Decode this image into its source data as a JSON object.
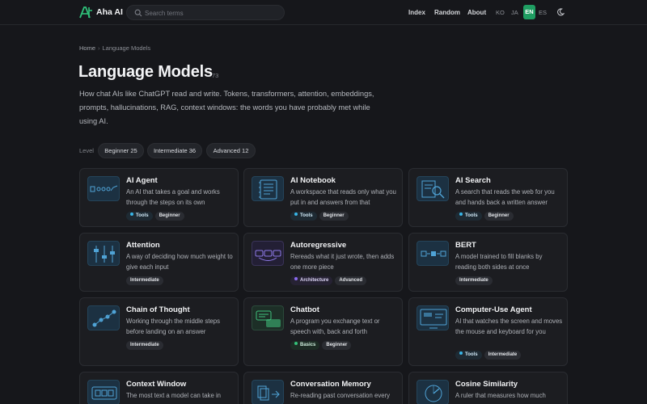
{
  "header": {
    "brand": "Aha AI",
    "search_placeholder": "Search terms",
    "nav": [
      "Index",
      "Random",
      "About"
    ],
    "languages": [
      "KO",
      "JA",
      "EN",
      "ES"
    ],
    "active_language": "EN"
  },
  "breadcrumb": {
    "home": "Home",
    "separator": "›",
    "current": "Language Models"
  },
  "page": {
    "title": "Language Models",
    "count": "73",
    "intro": "How chat AIs like ChatGPT read and write. Tokens, transformers, attention, embeddings, prompts, hallucinations, RAG, context windows: the words you have probably met while using AI."
  },
  "levels": {
    "label": "Level",
    "chips": [
      "Beginner 25",
      "Intermediate 36",
      "Advanced 12"
    ]
  },
  "cards": [
    {
      "title": "AI Agent",
      "desc": "An AI that takes a goal and works through the steps on its own",
      "category": "Tools",
      "level": "Beginner",
      "icon": "agent-icon"
    },
    {
      "title": "AI Notebook",
      "desc": "A workspace that reads only what you put in and answers from that",
      "category": "Tools",
      "level": "Beginner",
      "icon": "notebook-icon"
    },
    {
      "title": "AI Search",
      "desc": "A search that reads the web for you and hands back a written answer",
      "category": "Tools",
      "level": "Beginner",
      "icon": "search-doc-icon"
    },
    {
      "title": "Attention",
      "desc": "A way of deciding how much weight to give each input",
      "category": "",
      "level": "Intermediate",
      "icon": "sliders-icon"
    },
    {
      "title": "Autoregressive",
      "desc": "Rereads what it just wrote, then adds one more piece",
      "category": "Architecture",
      "level": "Advanced",
      "icon": "sequence-icon"
    },
    {
      "title": "BERT",
      "desc": "A model trained to fill blanks by reading both sides at once",
      "category": "",
      "level": "Intermediate",
      "icon": "bidirectional-icon"
    },
    {
      "title": "Chain of Thought",
      "desc": "Working through the middle steps before landing on an answer",
      "category": "",
      "level": "Intermediate",
      "icon": "chain-icon"
    },
    {
      "title": "Chatbot",
      "desc": "A program you exchange text or speech with, back and forth",
      "category": "Basics",
      "level": "Beginner",
      "icon": "chat-icon"
    },
    {
      "title": "Computer-Use Agent",
      "desc": "AI that watches the screen and moves the mouse and keyboard for you",
      "category": "Tools",
      "level": "Intermediate",
      "icon": "screen-icon"
    },
    {
      "title": "Context Window",
      "desc": "The most text a model can take in",
      "category": "",
      "level": "",
      "icon": "window-icon"
    },
    {
      "title": "Conversation Memory",
      "desc": "Re-reading past conversation every",
      "category": "",
      "level": "",
      "icon": "memory-icon"
    },
    {
      "title": "Cosine Similarity",
      "desc": "A ruler that measures how much",
      "category": "",
      "level": "",
      "icon": "gauge-icon"
    }
  ]
}
